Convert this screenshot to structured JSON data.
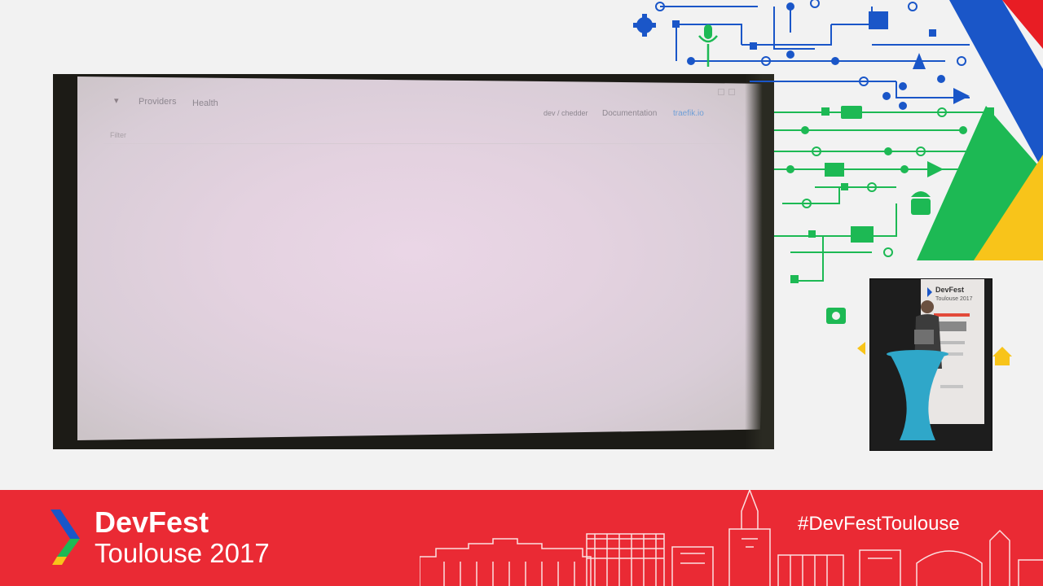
{
  "projected_app": {
    "nav_tabs": [
      "Providers",
      "Health"
    ],
    "right_links": [
      "dev / chedder",
      "Documentation",
      "traefik.io"
    ],
    "filter_placeholder": "Filter",
    "accent_link_color": "#6f9fd6"
  },
  "camera": {
    "poster_title": "DevFest",
    "poster_sub": "Toulouse 2017"
  },
  "banner": {
    "title": "DevFest",
    "subtitle": "Toulouse 2017",
    "hashtag": "#DevFestToulouse",
    "background_color": "#ea2a34"
  },
  "colors": {
    "blue": "#1a56c8",
    "green": "#1db954",
    "yellow": "#f8c41a",
    "red": "#e81d24"
  }
}
